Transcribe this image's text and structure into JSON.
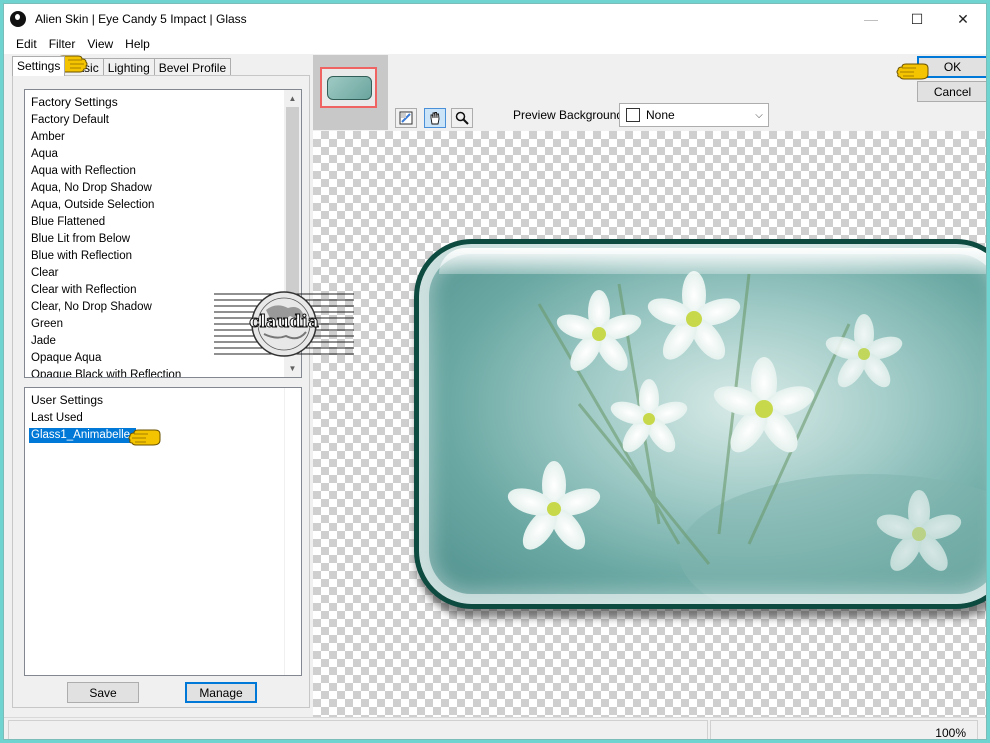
{
  "window": {
    "title": "Alien Skin | Eye Candy 5 Impact | Glass",
    "minimize": "—",
    "maximize": "☐",
    "close": "✕"
  },
  "menu": [
    "Edit",
    "Filter",
    "View",
    "Help"
  ],
  "tabs": [
    "Settings",
    "Basic",
    "Lighting",
    "Bevel Profile"
  ],
  "factory_settings": {
    "header": "Factory Settings",
    "items": [
      "Factory Default",
      "Amber",
      "Aqua",
      "Aqua with Reflection",
      "Aqua, No Drop Shadow",
      "Aqua, Outside Selection",
      "Blue Flattened",
      "Blue Lit from Below",
      "Blue with Reflection",
      "Clear",
      "Clear with Reflection",
      "Clear, No Drop Shadow",
      "Green",
      "Jade",
      "Opaque Aqua",
      "Opaque Black with Reflection"
    ]
  },
  "user_settings": {
    "header": "User Settings",
    "items": [
      "Last Used"
    ],
    "selected": "Glass1_Animabelle"
  },
  "buttons": {
    "save": "Save",
    "manage": "Manage",
    "ok": "OK",
    "cancel": "Cancel"
  },
  "preview": {
    "background_label": "Preview Background:",
    "background_value": "None"
  },
  "status": {
    "zoom": "100%"
  },
  "watermark": {
    "text": "claudia"
  },
  "colors": {
    "desktop": "#6fd3cf",
    "selection": "#0078d7",
    "glass_border": "#0d4a3f",
    "pointer": "#f5c400"
  },
  "icons": {
    "tool_1": "preview-toggle-icon",
    "tool_2": "hand-icon",
    "tool_3": "zoom-icon"
  }
}
